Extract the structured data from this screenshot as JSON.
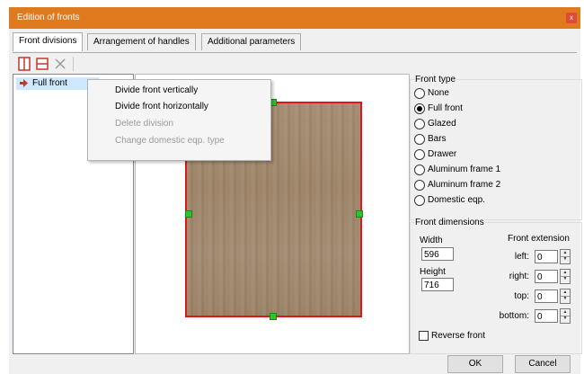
{
  "window": {
    "title": "Edition of fronts",
    "close_label": "x",
    "title_color": "#e07a1f"
  },
  "tabs": [
    {
      "label": "Front divisions",
      "active": true
    },
    {
      "label": "Arrangement of handles",
      "active": false
    },
    {
      "label": "Additional parameters",
      "active": false
    }
  ],
  "toolbar": {
    "buttons": [
      {
        "icon": "divide-vertical-icon"
      },
      {
        "icon": "divide-horizontal-icon"
      },
      {
        "icon": "delete-icon"
      }
    ]
  },
  "tree": {
    "items": [
      {
        "label": "Full front",
        "icon": "red-arrow-icon",
        "selected": true
      }
    ]
  },
  "context_menu": {
    "items": [
      {
        "label": "Divide front vertically",
        "enabled": true
      },
      {
        "label": "Divide front horizontally",
        "enabled": true
      },
      {
        "label": "Delete division",
        "enabled": false
      },
      {
        "label": "Change domestic eqp. type",
        "enabled": false
      }
    ]
  },
  "front_type": {
    "title": "Front type",
    "options": [
      "None",
      "Full front",
      "Glazed",
      "Bars",
      "Drawer",
      "Aluminum frame 1",
      "Aluminum frame 2",
      "Domestic eqp."
    ],
    "selected": "Full front"
  },
  "front_dimensions": {
    "title": "Front dimensions",
    "width_label": "Width",
    "width_value": "596",
    "height_label": "Height",
    "height_value": "716",
    "extension_label": "Front extension",
    "left_label": "left:",
    "left_value": "0",
    "right_label": "right:",
    "right_value": "0",
    "top_label": "top:",
    "top_value": "0",
    "bottom_label": "bottom:",
    "bottom_value": "0"
  },
  "reverse_front": {
    "label": "Reverse front",
    "checked": false
  },
  "buttons": {
    "ok": "OK",
    "cancel": "Cancel"
  },
  "colors": {
    "selection_border": "#d7191c",
    "handle": "#2fc32f",
    "tree_selection": "#cde8ff"
  }
}
